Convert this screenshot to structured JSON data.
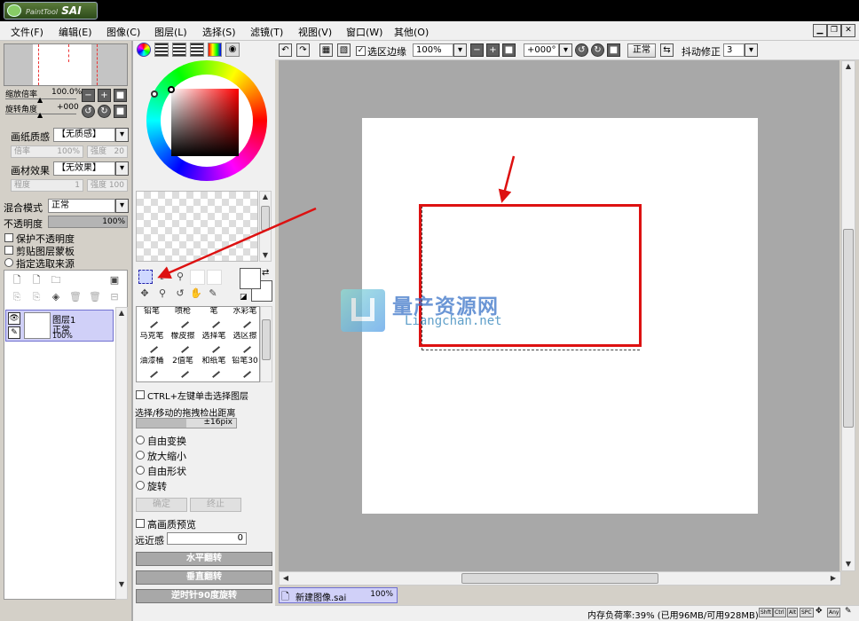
{
  "app": {
    "logo_text": "SAI",
    "logo_prefix": "PaintTool"
  },
  "menu": [
    "文件(F)",
    "编辑(E)",
    "图像(C)",
    "图层(L)",
    "选择(S)",
    "滤镜(T)",
    "视图(V)",
    "窗口(W)",
    "其他(O)"
  ],
  "nav": {
    "zoom_label": "缩放倍率",
    "zoom_value": "100.0%",
    "rotate_label": "旋转角度",
    "rotate_value": "+000"
  },
  "paper": {
    "texture_label": "画纸质感",
    "texture_value": "【无质感】",
    "scale_label": "倍率",
    "scale_value": "100%",
    "strength_label": "强度",
    "strength_value": "20",
    "effect_label": "画材效果",
    "effect_value": "【无效果】",
    "degree_label": "程度",
    "degree_value": "1",
    "effect_strength_value": "100"
  },
  "layer_props": {
    "blend_label": "混合模式",
    "blend_value": "正常",
    "opacity_label": "不透明度",
    "opacity_value": "100%",
    "opacity_fraction": 1.0,
    "protect_label": "保护不透明度",
    "clip_label": "剪贴图层蒙板",
    "source_label": "指定选取来源"
  },
  "layers": [
    {
      "name": "图层1",
      "mode": "正常",
      "opacity": "100%"
    }
  ],
  "tools": [
    {
      "name": "铅笔"
    },
    {
      "name": "喷枪"
    },
    {
      "name": "笔"
    },
    {
      "name": "水彩笔"
    },
    {
      "name": "马克笔"
    },
    {
      "name": "橡皮擦"
    },
    {
      "name": "选择笔"
    },
    {
      "name": "选区擦"
    },
    {
      "name": "油漆桶"
    },
    {
      "name": "2值笔"
    },
    {
      "name": "和纸笔"
    },
    {
      "name": "铅笔30"
    }
  ],
  "selection_opts": {
    "ctrl_label": "CTRL+左键单击选择图层",
    "drag_label": "选择/移动的拖拽检出距离",
    "drag_value": "±16pix",
    "free_transform": "自由变换",
    "scale": "放大缩小",
    "free_shape": "自由形状",
    "rotate": "旋转",
    "ok": "确定",
    "stop": "终止",
    "hq_preview": "高画质预览",
    "perspective_label": "远近感",
    "perspective_value": "0",
    "flip_h": "水平翻转",
    "flip_v": "垂直翻转",
    "rotate_ccw": "逆时针90度旋转"
  },
  "toolbar": {
    "select_edge_label": "选区边缘",
    "zoom_value": "100%",
    "angle_value": "+000°",
    "mode_value": "正常",
    "stabilizer_label": "抖动修正",
    "stabilizer_value": "3"
  },
  "watermark": {
    "title": "量产资源网",
    "url": "Liangchan.net"
  },
  "doc_tab": {
    "name": "新建图像.sai",
    "zoom": "100%"
  },
  "status": {
    "memory": "内存负荷率:39% (已用96MB/可用928MB)",
    "keys": [
      "Shft",
      "Ctrl",
      "Alt",
      "SPC",
      "Any"
    ]
  },
  "colors": {
    "title_bg": "#000000",
    "canvas_bg": "#a8a8a8",
    "selection_red": "#dd1111",
    "layer_selected": "#d0d0f8",
    "accent_blue": "#2255cc"
  }
}
